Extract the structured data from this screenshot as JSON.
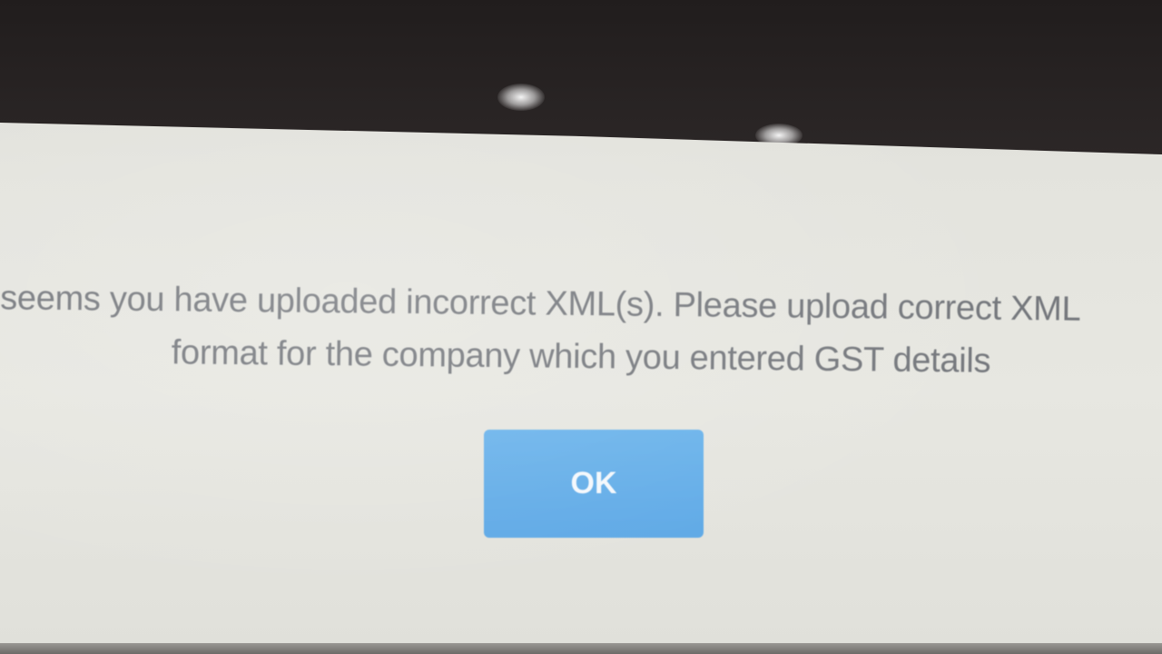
{
  "dialog": {
    "message_line1": "t seems you have uploaded incorrect XML(s). Please upload correct XML",
    "message_line2": "format for the company which you entered GST details",
    "ok_label": "OK"
  },
  "colors": {
    "button": "#62ace8",
    "text": "#74777c",
    "dialog_bg": "#e5e5df"
  }
}
